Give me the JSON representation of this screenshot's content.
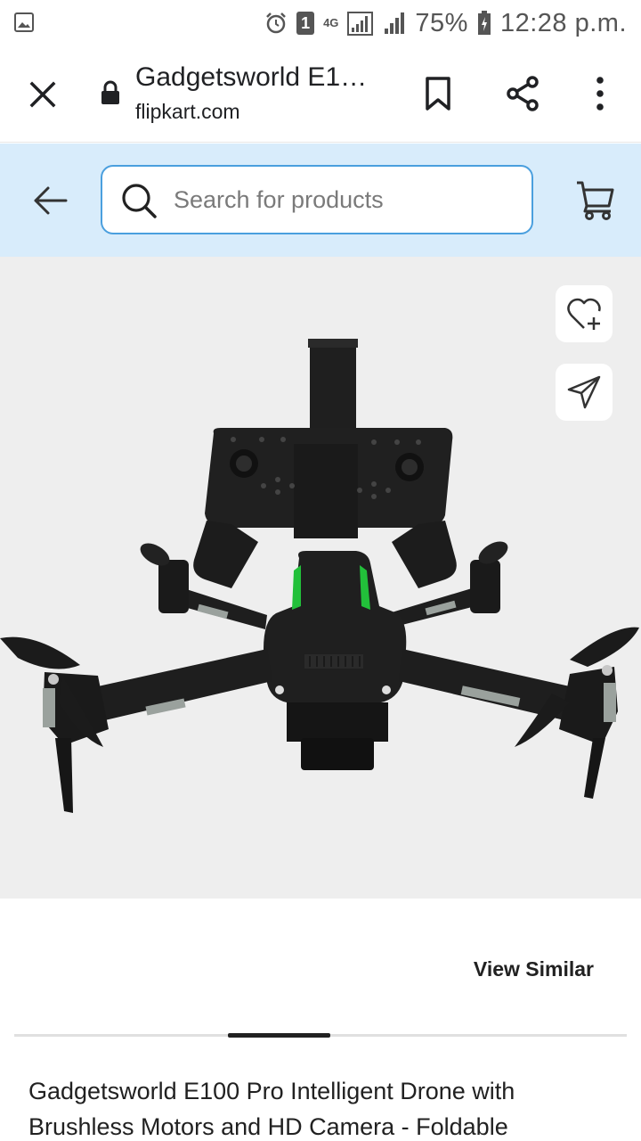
{
  "status_bar": {
    "battery": "75%",
    "time": "12:28 p.m.",
    "sim_badge": "1",
    "network": "4G"
  },
  "browser": {
    "page_title": "Gadgetsworld E1…",
    "url": "flipkart.com"
  },
  "search": {
    "placeholder": "Search for products"
  },
  "product": {
    "view_similar": "View Similar",
    "title": "Gadgetsworld E100 Pro Intelligent Drone with Brushless Motors and HD Camera - Foldable",
    "image_background": "#eeeeee",
    "accent_green": "#22c03a"
  },
  "colors": {
    "header_bg": "#d8ecfb",
    "search_border": "#4a9fde"
  },
  "icons": [
    "image-icon",
    "alarm-icon",
    "signal-icon",
    "battery-icon",
    "close-icon",
    "lock-icon",
    "bookmark-icon",
    "share-icon",
    "more-icon",
    "back-arrow-icon",
    "search-icon",
    "cart-icon",
    "wishlist-add-icon",
    "send-icon"
  ]
}
